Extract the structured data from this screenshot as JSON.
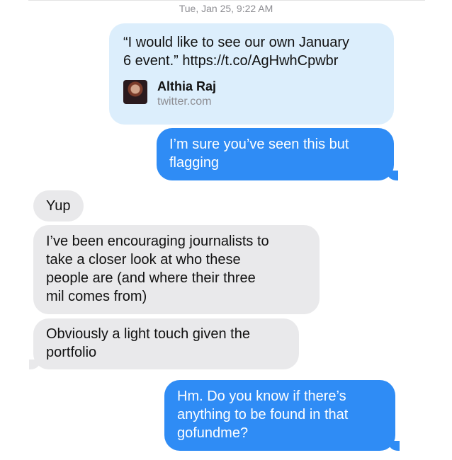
{
  "timestamp": "Tue, Jan 25, 9:22 AM",
  "messages": {
    "link_message": {
      "text": "“I would like to see our own January\n6 event.” https://t.co/AgHwhCpwbr",
      "preview": {
        "title": "Althia Raj",
        "domain": "twitter.com"
      }
    },
    "sent_1": "I’m sure you’ve seen this but\nflagging",
    "recv_1": "Yup",
    "recv_2": "I’ve been encouraging journalists to\ntake a closer look at who these\npeople are (and where their three\nmil comes from)",
    "recv_3": "Obviously a light touch given the\nportfolio",
    "sent_2": "Hm. Do you know if there’s\nanything to be found in that\ngofundme?"
  },
  "colors": {
    "sent_bubble": "#2f8cf5",
    "received_bubble": "#e9e9eb",
    "link_card": "#dceefc"
  }
}
